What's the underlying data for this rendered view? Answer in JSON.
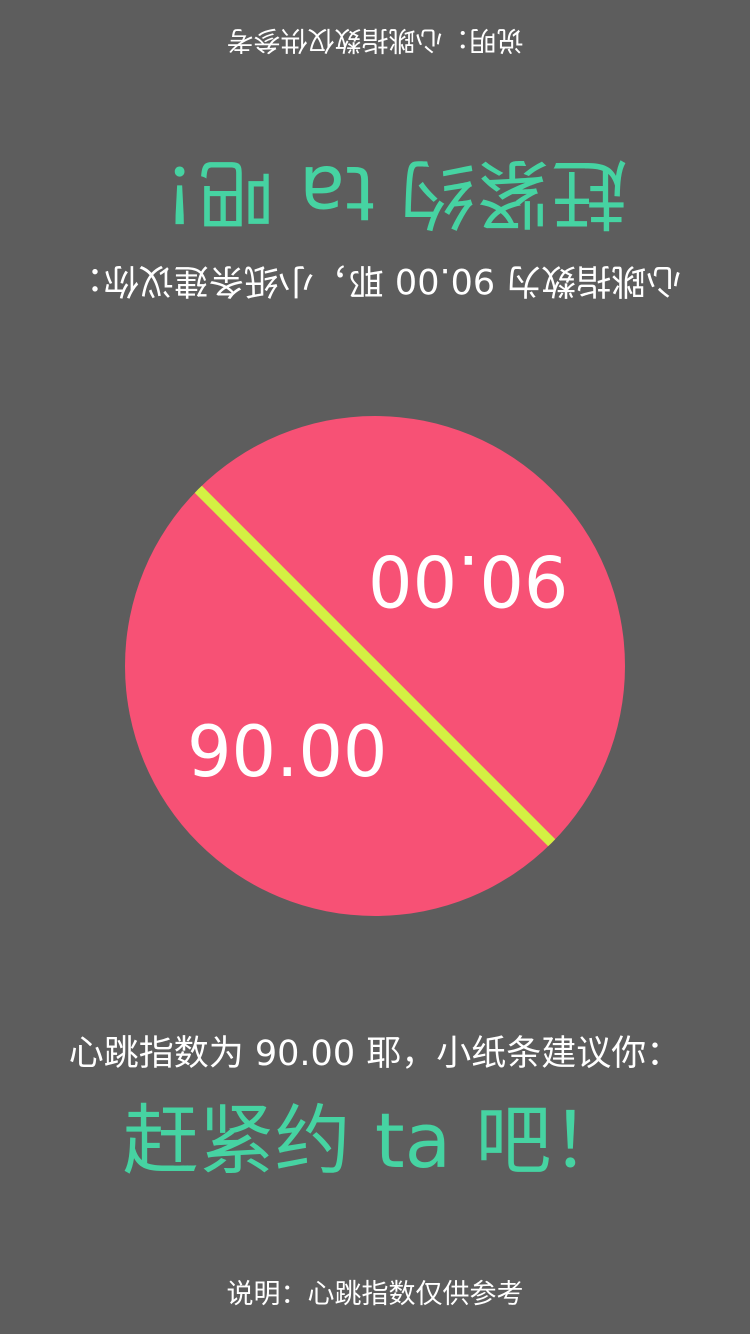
{
  "message": "心跳指数为 90.00 耶，小纸条建议你：",
  "call_to_action": "赶紧约 ta 吧！",
  "disclaimer": "说明：心跳指数仅供参考",
  "score": "90.00",
  "colors": {
    "background": "#5d5d5d",
    "dial": "#f75175",
    "divider": "#d4f043",
    "accent_text": "#46d3a2",
    "text": "#ffffff"
  }
}
